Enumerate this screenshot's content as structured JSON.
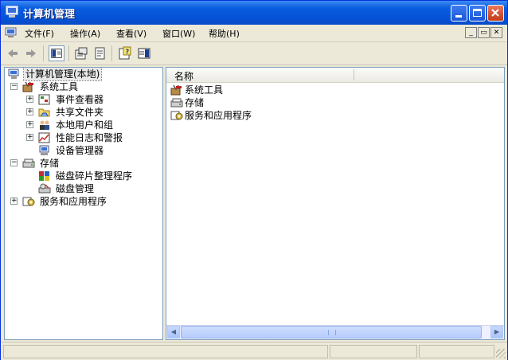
{
  "window": {
    "title": "计算机管理"
  },
  "menu": [
    "文件(F)",
    "操作(A)",
    "查看(V)",
    "窗口(W)",
    "帮助(H)"
  ],
  "tree": {
    "root": "计算机管理(本地)",
    "system_tools": "系统工具",
    "event_viewer": "事件查看器",
    "shared_folders": "共享文件夹",
    "local_users": "本地用户和组",
    "perf_logs": "性能日志和警报",
    "device_manager": "设备管理器",
    "storage": "存储",
    "defrag": "磁盘碎片整理程序",
    "disk_mgmt": "磁盘管理",
    "services_apps": "服务和应用程序"
  },
  "list": {
    "column_header": "名称",
    "items": [
      "系统工具",
      "存储",
      "服务和应用程序"
    ]
  },
  "icons": [
    "computer-icon",
    "back-arrow-icon",
    "forward-arrow-icon",
    "show-hide-tree-icon",
    "properties-icon",
    "export-list-icon",
    "help-icon",
    "console-icon"
  ],
  "colors": {
    "title_bar": "#0553d8",
    "close_button": "#c23a16",
    "selection": "#e8e8e8"
  }
}
